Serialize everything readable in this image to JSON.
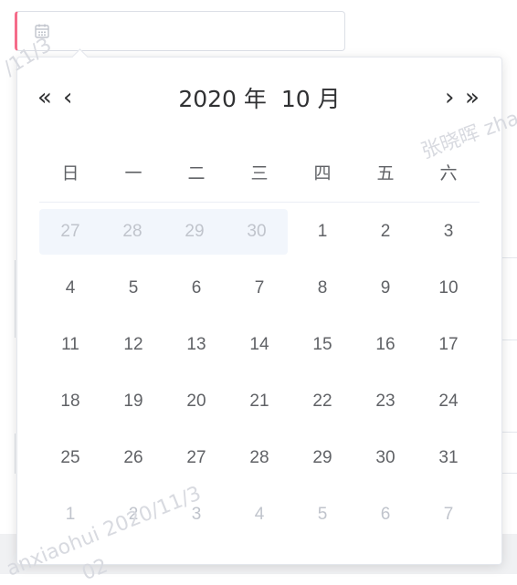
{
  "watermarks": {
    "a": "/11/3",
    "b": "张晓晖 zha",
    "c": "anxiaohui 2020/11/3",
    "d": "02"
  },
  "date_input": {
    "icon": "calendar-icon",
    "value": "",
    "placeholder": ""
  },
  "picker": {
    "prev_year": "«",
    "prev_month": "‹",
    "next_month": "›",
    "next_year": "»",
    "year_label": "2020 年",
    "month_label": "10 月",
    "weekdays": [
      "日",
      "一",
      "二",
      "三",
      "四",
      "五",
      "六"
    ],
    "weeks": [
      [
        "27",
        "28",
        "29",
        "30",
        "1",
        "2",
        "3"
      ],
      [
        "4",
        "5",
        "6",
        "7",
        "8",
        "9",
        "10"
      ],
      [
        "11",
        "12",
        "13",
        "14",
        "15",
        "16",
        "17"
      ],
      [
        "18",
        "19",
        "20",
        "21",
        "22",
        "23",
        "24"
      ],
      [
        "25",
        "26",
        "27",
        "28",
        "29",
        "30",
        "31"
      ],
      [
        "1",
        "2",
        "3",
        "4",
        "5",
        "6",
        "7"
      ]
    ]
  },
  "colors": {
    "accent_left_border": "#f56c8a",
    "text": "#606266",
    "muted": "#c0c4cc",
    "prev_bg": "#f2f6fc"
  }
}
